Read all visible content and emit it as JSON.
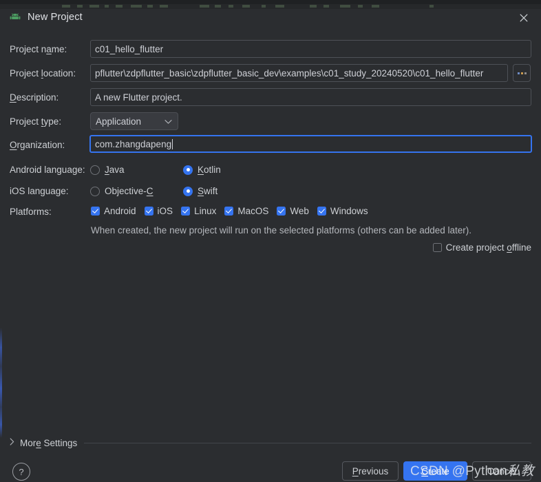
{
  "window": {
    "title": "New Project",
    "app_icon": "android-robot-icon",
    "close_icon": "close-icon"
  },
  "form": {
    "project_name": {
      "label_pre": "Project n",
      "label_mn": "a",
      "label_post": "me:",
      "value": "c01_hello_flutter"
    },
    "project_location": {
      "label_pre": "Project ",
      "label_mn": "l",
      "label_post": "ocation:",
      "value": "pflutter\\zdpflutter_basic\\zdpflutter_basic_dev\\examples\\c01_study_20240520\\c01_hello_flutter",
      "browse_label": "...",
      "browse_icon": "browse-dots-icon"
    },
    "description": {
      "label_pre": "",
      "label_mn": "D",
      "label_post": "escription:",
      "value": "A new Flutter project."
    },
    "project_type": {
      "label_pre": "Project ",
      "label_mn": "t",
      "label_post": "ype:",
      "value": "Application",
      "chevron_icon": "chevron-down-icon"
    },
    "organization": {
      "label_pre": "",
      "label_mn": "O",
      "label_post": "rganization:",
      "value": "com.zhangdapeng"
    },
    "android_language": {
      "label": "Android language:",
      "options": [
        {
          "pre": "",
          "mn": "J",
          "post": "ava",
          "selected": false
        },
        {
          "pre": "",
          "mn": "K",
          "post": "otlin",
          "selected": true
        }
      ]
    },
    "ios_language": {
      "label": "iOS language:",
      "options": [
        {
          "pre": "Objective-",
          "mn": "C",
          "post": "",
          "selected": false
        },
        {
          "pre": "",
          "mn": "S",
          "post": "wift",
          "selected": true
        }
      ]
    },
    "platforms": {
      "label": "Platforms:",
      "items": [
        {
          "label": "Android",
          "checked": true
        },
        {
          "label": "iOS",
          "checked": true
        },
        {
          "label": "Linux",
          "checked": true
        },
        {
          "label": "MacOS",
          "checked": true
        },
        {
          "label": "Web",
          "checked": true
        },
        {
          "label": "Windows",
          "checked": true
        }
      ],
      "hint": "When created, the new project will run on the selected platforms (others can be added later)."
    },
    "create_offline": {
      "pre": "Create project ",
      "mn": "o",
      "post": "ffline",
      "checked": false
    }
  },
  "more_settings": {
    "pre": "Mor",
    "mn": "e",
    "post": " Settings",
    "chevron_icon": "chevron-right-icon"
  },
  "footer": {
    "help_label": "?",
    "previous": {
      "pre": "",
      "mn": "P",
      "post": "revious"
    },
    "create": {
      "pre": "",
      "mn": "C",
      "post": "reate"
    },
    "cancel": {
      "pre": "Cancel",
      "mn": "",
      "post": ""
    }
  },
  "watermark": {
    "latin": "CSDN @Python",
    "cjk": "私教"
  },
  "colors": {
    "accent": "#3574f0",
    "dialog_bg": "#2b2d30",
    "field_border": "#4e5157",
    "text": "#cdd0d4",
    "android_green": "#3ddc84"
  }
}
